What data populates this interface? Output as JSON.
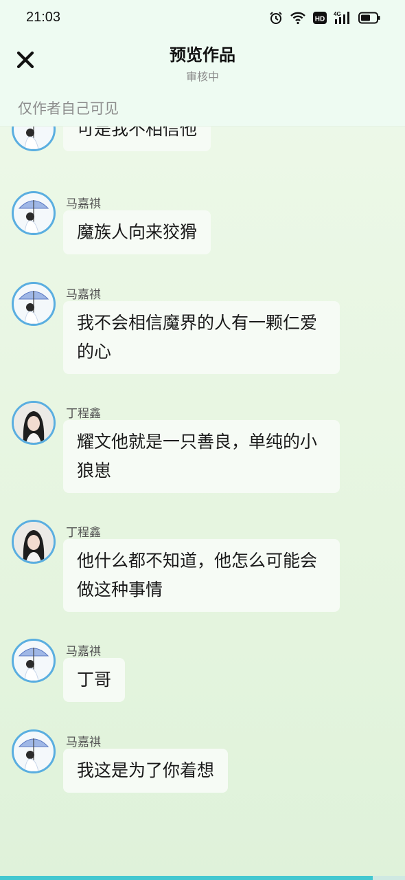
{
  "status": {
    "time": "21:03",
    "icons": [
      "alarm-icon",
      "wifi-icon",
      "hd-icon",
      "4g-signal-icon",
      "battery-icon"
    ]
  },
  "header": {
    "title": "预览作品",
    "subtitle": "审核中",
    "close_icon": "close-icon"
  },
  "notice": "仅作者自己可见",
  "messages": [
    {
      "sender": "",
      "text": "可是我不相信他",
      "avatar": "umbrella"
    },
    {
      "sender": "马嘉祺",
      "text": "魔族人向来狡猾",
      "avatar": "umbrella"
    },
    {
      "sender": "马嘉祺",
      "text": "我不会相信魔界的人有一颗仁爱的心",
      "avatar": "umbrella"
    },
    {
      "sender": "丁程鑫",
      "text": "耀文他就是一只善良，单纯的小狼崽",
      "avatar": "portrait"
    },
    {
      "sender": "丁程鑫",
      "text": "他什么都不知道，他怎么可能会做这种事情",
      "avatar": "portrait"
    },
    {
      "sender": "马嘉祺",
      "text": "丁哥",
      "avatar": "umbrella"
    },
    {
      "sender": "马嘉祺",
      "text": "我这是为了你着想",
      "avatar": "umbrella"
    }
  ],
  "colors": {
    "accent": "#43c8d0",
    "avatar_ring": "#5aaee0",
    "background": "#e6f5e0",
    "bubble": "#f6fbf5"
  },
  "progress": 0.92
}
